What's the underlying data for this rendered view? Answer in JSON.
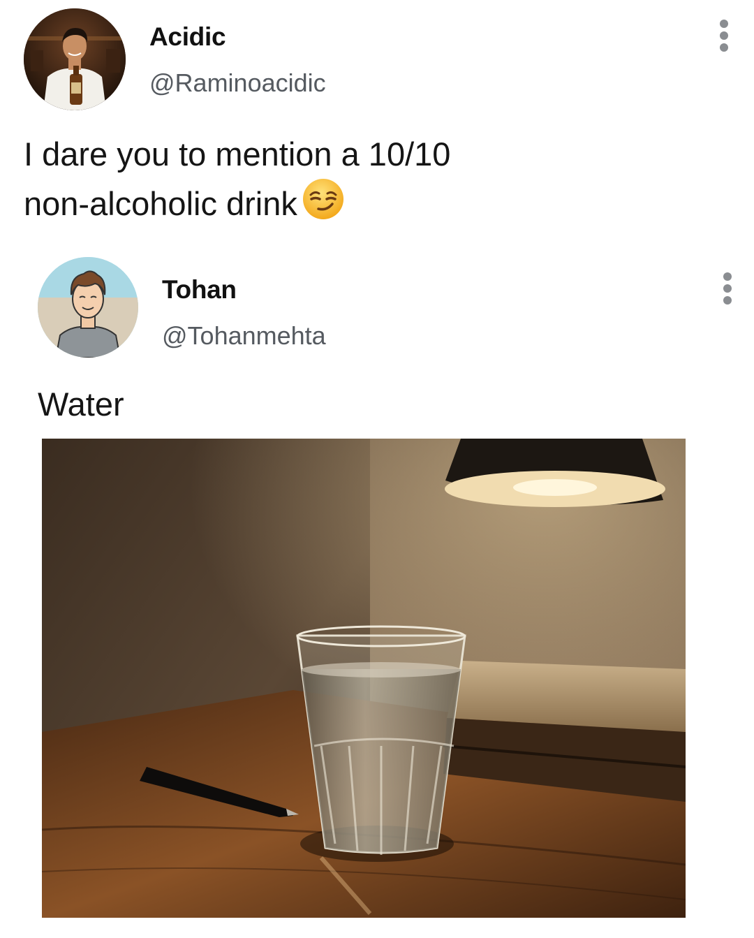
{
  "tweet": {
    "author_name": "Acidic",
    "author_handle": "@Raminoacidic",
    "text": "I dare you to mention a 10/10 non-alcoholic drink",
    "text_line1": "I dare you to mention a 10/10",
    "text_line2": "non-alcoholic drink",
    "emoji": "smirking-face-emoji",
    "more_icon": "more-vertical-icon"
  },
  "reply": {
    "author_name": "Tohan",
    "author_handle": "@Tohanmehta",
    "text": "Water",
    "more_icon": "more-vertical-icon",
    "image": "glass-of-water-photo"
  },
  "colors": {
    "background": "#ffffff",
    "text": "#111111",
    "handle": "#555a60",
    "icon": "#8a8d91"
  }
}
